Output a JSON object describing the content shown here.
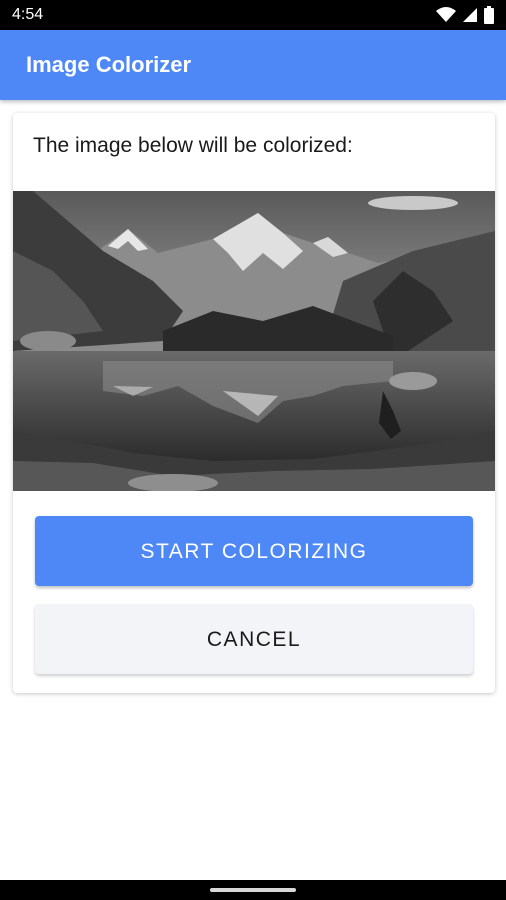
{
  "status_bar": {
    "time": "4:54",
    "icons": [
      "wifi-icon",
      "signal-icon",
      "battery-icon"
    ]
  },
  "app_bar": {
    "title": "Image Colorizer",
    "color": "#4d88f6"
  },
  "card": {
    "text": "The image below will be colorized:",
    "image": {
      "description_icon": "grayscale-landscape-photo"
    },
    "buttons": {
      "start_label": "START COLORIZING",
      "cancel_label": "CANCEL"
    }
  },
  "colors": {
    "accent": "#4d88f6",
    "cancel_bg": "#f2f4f7",
    "status_bar": "#000000"
  }
}
